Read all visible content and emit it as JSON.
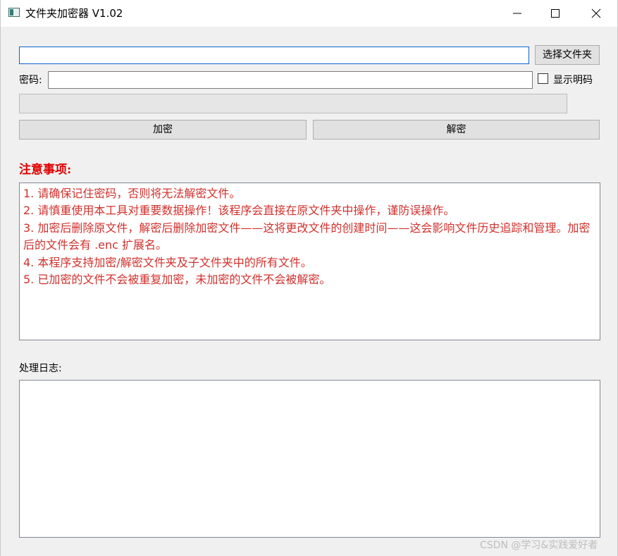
{
  "window": {
    "title": "文件夹加密器 V1.02"
  },
  "folder": {
    "path_value": "",
    "choose_label": "选择文件夹"
  },
  "password": {
    "label": "密码:",
    "value": "",
    "show_plain_label": "显示明码",
    "show_plain_checked": false
  },
  "progress": {
    "value_percent": 0
  },
  "actions": {
    "encrypt_label": "加密",
    "decrypt_label": "解密"
  },
  "notes": {
    "title": "注意事项:",
    "lines": [
      "1. 请确保记住密码，否则将无法解密文件。",
      "2. 请慎重使用本工具对重要数据操作！该程序会直接在原文件夹中操作，谨防误操作。",
      "3. 加密后删除原文件，解密后删除加密文件——这将更改文件的创建时间——这会影响文件历史追踪和管理。加密后的文件会有 .enc 扩展名。",
      "4. 本程序支持加密/解密文件夹及子文件夹中的所有文件。",
      "5. 已加密的文件不会被重复加密，未加密的文件不会被解密。"
    ],
    "color": "#d0312d"
  },
  "log": {
    "label": "处理日志:",
    "content": ""
  },
  "watermark": "CSDN @学习&实践爱好者",
  "icons": {
    "app": "folder-encryptor-app-icon",
    "minimize": "minimize-icon",
    "maximize": "maximize-icon",
    "close": "close-icon"
  }
}
